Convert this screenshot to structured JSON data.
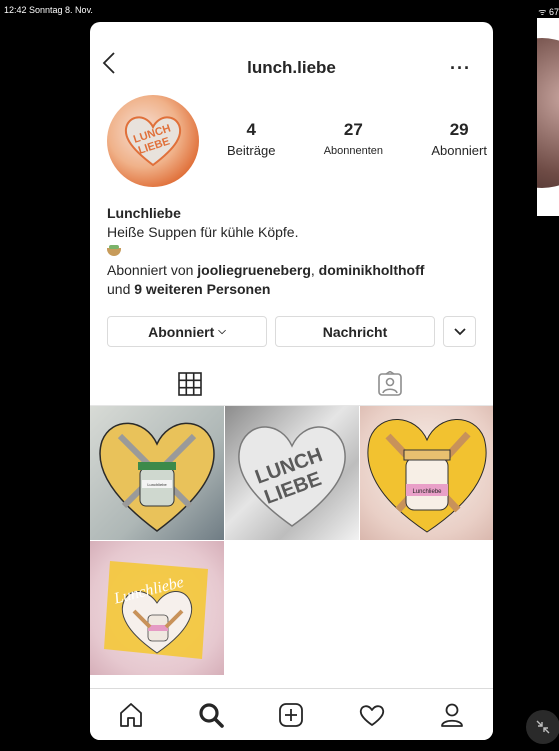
{
  "status_bar": {
    "time_date": "12:42  Sonntag 8. Nov.",
    "right": "ᯤ 67"
  },
  "header": {
    "title": "lunch.liebe",
    "more": "···"
  },
  "profile": {
    "avatar_text_1": "LUNCH",
    "avatar_text_2": "LIEBE",
    "stats": [
      {
        "num": "4",
        "label": "Beiträge"
      },
      {
        "num": "27",
        "label": "Abonnenten"
      },
      {
        "num": "29",
        "label": "Abonniert"
      }
    ]
  },
  "bio": {
    "name": "Lunchliebe",
    "line1": "Heiße Suppen für kühle Köpfe.",
    "followed_by_prefix": "Abonniert von ",
    "followed_user1": "jooliegrueneberg",
    "separator": ", ",
    "followed_user2": "dominikholthoff",
    "and": "und ",
    "others": "9 weiteren Personen"
  },
  "buttons": {
    "follow": "Abonniert",
    "message": "Nachricht"
  },
  "tiles": {
    "t1_label": "Lunchliebe",
    "t2_text1": "LUNCH",
    "t2_text2": "LIEBE",
    "t3_label": "Lunchliebe",
    "t4_script": "Lunchliebe"
  },
  "colors": {
    "text": "#262626",
    "border": "#dbdbdb",
    "yellow": "#f2c230",
    "orange": "#e0703a"
  }
}
